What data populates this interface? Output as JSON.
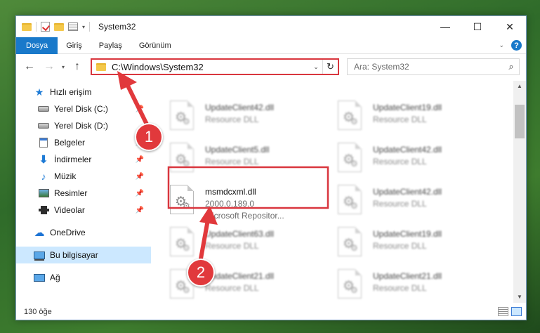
{
  "window": {
    "title": "System32",
    "controls": {
      "minimize": "—",
      "maximize": "☐",
      "close": "✕"
    }
  },
  "ribbon": {
    "tabs": [
      "Dosya",
      "Giriş",
      "Paylaş",
      "Görünüm"
    ]
  },
  "nav": {
    "back": "←",
    "forward": "→",
    "recent": "▾",
    "up": "↑",
    "address": "C:\\Windows\\System32",
    "address_dropdown": "⌄",
    "refresh": "↻",
    "search_placeholder": "Ara: System32",
    "search_icon": "⌕"
  },
  "sidebar": {
    "items": [
      {
        "label": "Hızlı erişim",
        "icon": "star-icon",
        "pinned": false
      },
      {
        "label": "Yerel Disk (C:)",
        "icon": "disk-icon",
        "pinned": true
      },
      {
        "label": "Yerel Disk (D:)",
        "icon": "disk-icon",
        "pinned": false
      },
      {
        "label": "Belgeler",
        "icon": "document-icon",
        "pinned": true
      },
      {
        "label": "İndirmeler",
        "icon": "download-icon",
        "pinned": true
      },
      {
        "label": "Müzik",
        "icon": "music-icon",
        "pinned": true
      },
      {
        "label": "Resimler",
        "icon": "pictures-icon",
        "pinned": true
      },
      {
        "label": "Videolar",
        "icon": "video-icon",
        "pinned": true
      },
      {
        "label": "OneDrive",
        "icon": "cloud-icon",
        "pinned": false
      },
      {
        "label": "Bu bilgisayar",
        "icon": "computer-icon",
        "pinned": false,
        "selected": true
      },
      {
        "label": "Ağ",
        "icon": "network-icon",
        "pinned": false
      }
    ]
  },
  "files": {
    "left_column": [
      {
        "name": "UpdateClient42.dll",
        "sub": "Resource DLL"
      },
      {
        "name": "UpdateClient5.dll",
        "sub": "Resource DLL"
      },
      {
        "name": "msmdcxml.dll",
        "sub": "2000.0.189.0",
        "sub2": "Microsoft Repositor...",
        "highlighted": true
      },
      {
        "name": "UpdateClient63.dll",
        "sub": "Resource DLL"
      },
      {
        "name": "UpdateClient21.dll",
        "sub": "Resource DLL"
      }
    ],
    "right_column": [
      {
        "name": "UpdateClient19.dll",
        "sub": "Resource DLL"
      },
      {
        "name": "UpdateClient42.dll",
        "sub": "Resource DLL"
      },
      {
        "name": "UpdateClient42.dll",
        "sub": "Resource DLL"
      },
      {
        "name": "UpdateClient19.dll",
        "sub": "Resource DLL"
      },
      {
        "name": "UpdateClient21.dll",
        "sub": "Resource DLL"
      }
    ]
  },
  "status": {
    "item_count": "130 öğe"
  },
  "annotations": {
    "step1": "1",
    "step2": "2",
    "color": "#e1393c"
  }
}
